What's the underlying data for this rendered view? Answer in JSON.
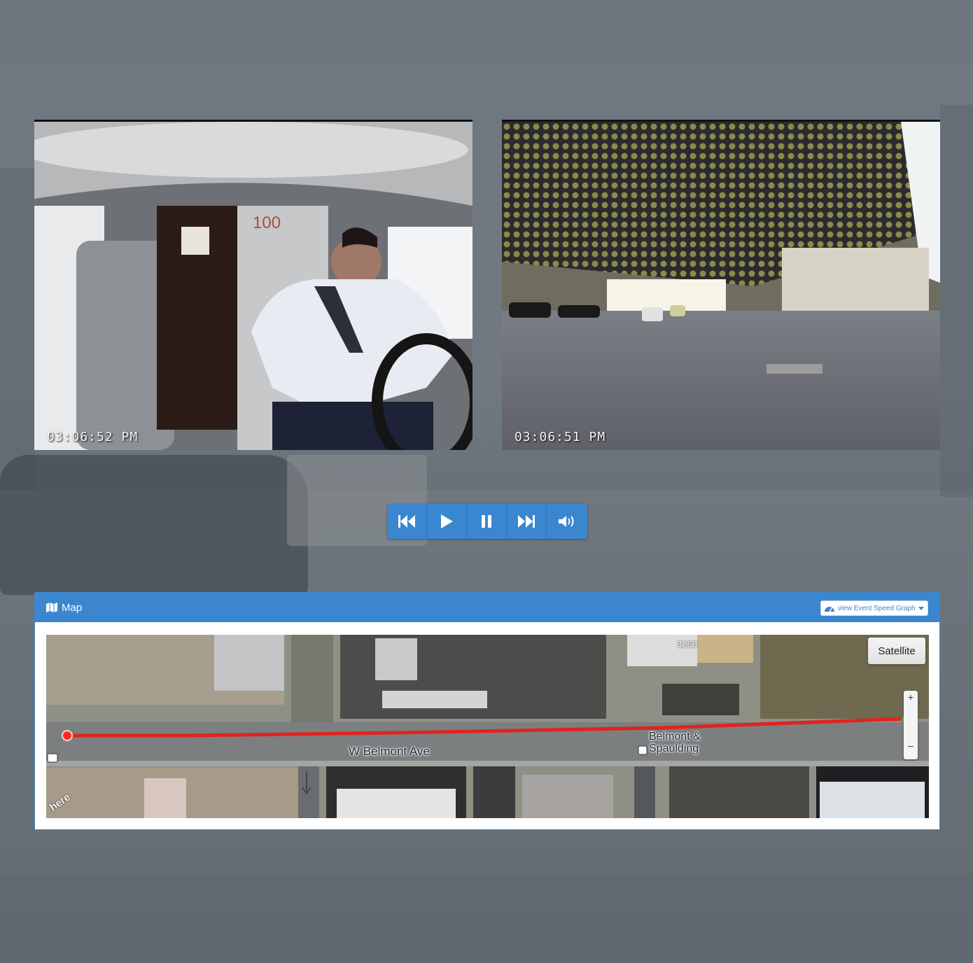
{
  "cameras": {
    "cabin": {
      "timestamp": "03:06:52 PM",
      "unit_marking": "100"
    },
    "road": {
      "timestamp": "03:06:51 PM"
    }
  },
  "player": {
    "controls": [
      "skip-back",
      "play",
      "pause",
      "fast-forward",
      "volume"
    ]
  },
  "map_panel": {
    "title": "Map",
    "speed_graph_label": "view Event Speed Graph",
    "satellite_label": "Satellite",
    "zoom_in": "+",
    "zoom_out": "–",
    "street_label": "W Belmont Ave",
    "stop_line1": "Belmont &",
    "stop_line2": "Spaulding",
    "building_number": "3260",
    "logo": "here"
  },
  "colors": {
    "accent": "#3a87d0",
    "route": "#e0231f"
  }
}
